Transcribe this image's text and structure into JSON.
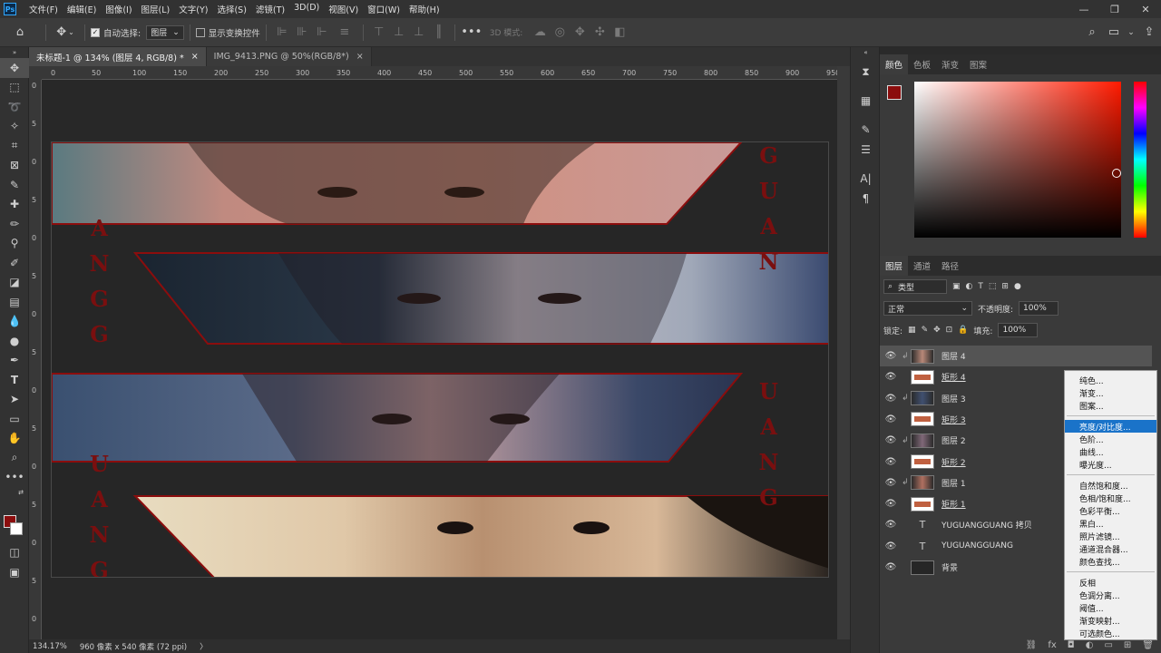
{
  "app": {
    "logo": "Ps"
  },
  "menu": [
    "文件(F)",
    "编辑(E)",
    "图像(I)",
    "图层(L)",
    "文字(Y)",
    "选择(S)",
    "滤镜(T)",
    "3D(D)",
    "视图(V)",
    "窗口(W)",
    "帮助(H)"
  ],
  "options": {
    "auto_select_label": "自动选择:",
    "auto_select_value": "图层",
    "show_transform_label": "显示变换控件",
    "mode_3d_label": "3D 模式:"
  },
  "tabs": [
    {
      "label": "未标题-1 @ 134% (图层 4, RGB/8) *",
      "active": true
    },
    {
      "label": "IMG_9413.PNG @ 50%(RGB/8*)",
      "active": false
    }
  ],
  "ruler_top": [
    "0",
    "50",
    "100",
    "150",
    "200",
    "250",
    "300",
    "350",
    "400",
    "450",
    "500",
    "550",
    "600",
    "650",
    "700",
    "750",
    "800",
    "850",
    "900",
    "950"
  ],
  "ruler_left": [
    "0",
    "5",
    "0",
    "5",
    "0",
    "5",
    "0",
    "5",
    "0",
    "5",
    "0",
    "5",
    "0",
    "5",
    "0"
  ],
  "artwork": {
    "vertical_text_left_1": "ANGG",
    "vertical_text_left_2": "UANG",
    "vertical_text_right_1": "GUAN",
    "vertical_text_right_2": "UANG",
    "colors": {
      "red": "#8b0d0d",
      "bg": "#262626"
    }
  },
  "status": {
    "zoom": "134.17%",
    "doc_size": "960 像素 x 540 像素 (72 ppi)",
    "arrow": "〉"
  },
  "color_panel": {
    "tabs": [
      "颜色",
      "色板",
      "渐变",
      "图案"
    ],
    "foreground": "#8b0d0d",
    "background": "#ffffff"
  },
  "layers_panel": {
    "tabs": [
      "图层",
      "通道",
      "路径"
    ],
    "filter_label": "类型",
    "blend_mode": "正常",
    "opacity_label": "不透明度:",
    "opacity_value": "100%",
    "lock_label": "锁定:",
    "fill_label": "填充:",
    "fill_value": "100%",
    "layers": [
      {
        "name": "图层 4",
        "kind": "image",
        "clipped": true,
        "selected": true
      },
      {
        "name": "矩形 4",
        "kind": "shape",
        "clipped": false,
        "selected": false
      },
      {
        "name": "图层 3",
        "kind": "image",
        "clipped": true,
        "selected": false
      },
      {
        "name": "矩形 3",
        "kind": "shape",
        "clipped": false,
        "selected": false
      },
      {
        "name": "图层 2",
        "kind": "image",
        "clipped": true,
        "selected": false
      },
      {
        "name": "矩形 2",
        "kind": "shape",
        "clipped": false,
        "selected": false
      },
      {
        "name": "图层 1",
        "kind": "image",
        "clipped": true,
        "selected": false
      },
      {
        "name": "矩形 1",
        "kind": "shape",
        "clipped": false,
        "selected": false
      },
      {
        "name": "YUGUANGGUANG 拷贝",
        "kind": "text",
        "clipped": false,
        "selected": false
      },
      {
        "name": "YUGUANGGUANG",
        "kind": "text",
        "clipped": false,
        "selected": false
      },
      {
        "name": "背景",
        "kind": "fill",
        "clipped": false,
        "selected": false
      }
    ],
    "bottom_icons": [
      "link-icon",
      "fx-icon",
      "mask-icon",
      "adjustment-icon",
      "group-icon",
      "new-layer-icon",
      "trash-icon"
    ]
  },
  "adjustment_menu": [
    [
      "纯色...",
      "渐变...",
      "图案..."
    ],
    [
      "亮度/对比度...",
      "色阶...",
      "曲线...",
      "曝光度..."
    ],
    [
      "自然饱和度...",
      "色相/饱和度...",
      "色彩平衡...",
      "黑白...",
      "照片滤镜...",
      "通道混合器...",
      "颜色查找..."
    ],
    [
      "反相",
      "色调分离...",
      "阈值...",
      "渐变映射...",
      "可选颜色..."
    ]
  ],
  "adjustment_highlight": "亮度/对比度..."
}
